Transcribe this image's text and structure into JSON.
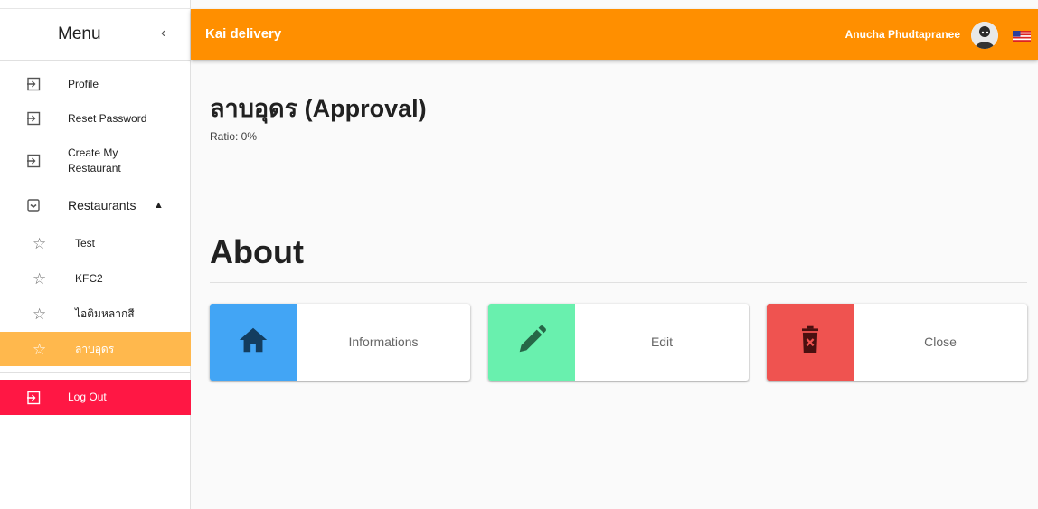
{
  "sidebar": {
    "title": "Menu",
    "collapse_icon": "chevron-left-icon",
    "items": [
      {
        "label": "Profile",
        "icon": "login-icon"
      },
      {
        "label": "Reset Password",
        "icon": "login-icon"
      },
      {
        "label": "Create My Restaurant",
        "icon": "login-icon"
      },
      {
        "label": "Restaurants",
        "icon": "inbox-icon",
        "expanded": true
      },
      {
        "label": "Log Out",
        "icon": "login-icon"
      }
    ],
    "restaurants": [
      {
        "label": "Test",
        "icon": "star-outline-icon",
        "active": false
      },
      {
        "label": "KFC2",
        "icon": "star-outline-icon",
        "active": false
      },
      {
        "label": "ไอติมหลากสี",
        "icon": "star-outline-icon",
        "active": false
      },
      {
        "label": "ลาบอุดร",
        "icon": "star-outline-icon",
        "active": true
      }
    ]
  },
  "header": {
    "brand": "Kai delivery",
    "user_name": "Anucha Phudtapranee",
    "avatar": "user-avatar",
    "flag": "us-flag-icon"
  },
  "main": {
    "title": "ลาบอุดร (Approval)",
    "ratio": "Ratio: 0%",
    "about_title": "About",
    "cards": [
      {
        "label": "Informations",
        "icon": "home-icon",
        "color": "#42a5f5"
      },
      {
        "label": "Edit",
        "icon": "pencil-icon",
        "color": "#69f0ae"
      },
      {
        "label": "Close",
        "icon": "delete-icon",
        "color": "#ef5350"
      }
    ]
  },
  "colors": {
    "topbar": "#ff8f00",
    "active_item": "#ffb84d",
    "logout": "#ff1744"
  }
}
